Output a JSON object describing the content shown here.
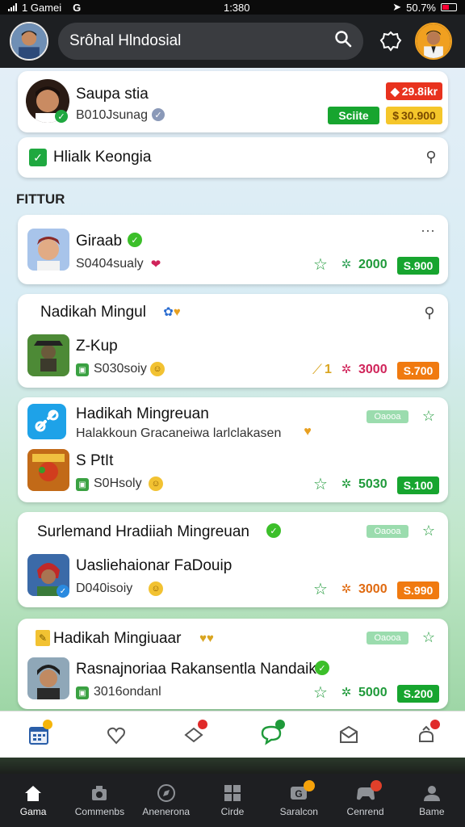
{
  "status_bar": {
    "carrier": "1 Gamei",
    "carrier_icon": "G",
    "time": "1:380",
    "battery": "50.7%"
  },
  "header": {
    "search_text": "Srôhal Hlndosial",
    "icons": [
      "avatar",
      "search-icon",
      "settings-gear-icon",
      "profile-avatar"
    ]
  },
  "section_label": "FITTUR",
  "cards": {
    "c1": {
      "title": "Saupa stia",
      "subtitle": "B010Jsunag",
      "badge_top": "29.8ikr",
      "badge_green": "Sciite",
      "badge_gold": "30.900"
    },
    "c2": {
      "title": "Hlialk Keongia"
    },
    "c3": {
      "title": "Giraab",
      "subtitle": "S0404sualy",
      "score": "2000",
      "price": "S.900"
    },
    "c4": {
      "header": "Nadikah Mingul",
      "title": "Z-Kup",
      "subtitle": "S030soiy",
      "count": "1",
      "score": "3000",
      "price": "S.700"
    },
    "c5": {
      "header": "Hadikah Mingreuan",
      "desc": "Halakkoun Gracaneiwa larlclakasen",
      "tag": "Oaooa",
      "title": "S PtIt",
      "subtitle": "S0Hsoly",
      "score": "5030",
      "price": "S.100"
    },
    "c6": {
      "header": "Surlemand Hradiiah Mingreuan",
      "tag": "Oaooa",
      "title": "Uasliehaionar FaDouip",
      "subtitle": "D040isoiy",
      "score": "3000",
      "price": "S.990"
    },
    "c7": {
      "header": "Hadikah Mingiuaar",
      "tag": "Oaooa",
      "title": "Rasnajnoriaa Rakansentla Nandaik",
      "subtitle": "3016ondanl",
      "score": "5000",
      "price": "S.200"
    }
  },
  "icon_row": [
    "calendar-icon",
    "heart-icon",
    "gift-icon",
    "chat-icon",
    "mail-icon",
    "user-gift-icon"
  ],
  "bottom_nav": [
    {
      "label": "Gama",
      "icon": "home-icon"
    },
    {
      "label": "Commenbs",
      "icon": "camera-icon"
    },
    {
      "label": "Anenerona",
      "icon": "compass-icon"
    },
    {
      "label": "Cirde",
      "icon": "grid-icon"
    },
    {
      "label": "Saralcon",
      "icon": "game-icon"
    },
    {
      "label": "Cenrend",
      "icon": "controller-icon"
    },
    {
      "label": "Bame",
      "icon": "profile-icon"
    }
  ]
}
